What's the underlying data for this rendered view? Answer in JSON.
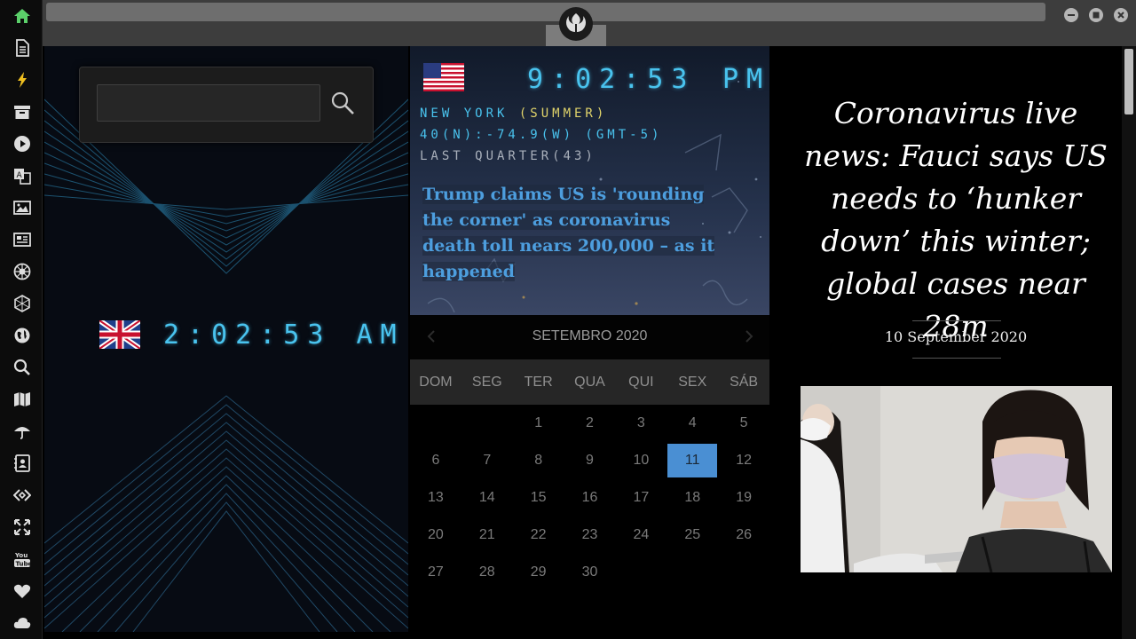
{
  "sidebar": {
    "icons": [
      "home-icon",
      "document-icon",
      "lightning-icon",
      "archive-icon",
      "play-icon",
      "translate-icon",
      "image-icon",
      "newspaper-icon",
      "rebel-alliance-icon",
      "hexagon-network-icon",
      "globe-icon",
      "search-icon",
      "map-icon",
      "umbrella-icon",
      "contacts-icon",
      "code-link-icon",
      "fullscreen-icon",
      "youtube-icon",
      "heart-icon",
      "cloud-icon"
    ],
    "active_color": "#5bd06a"
  },
  "window": {
    "controls": [
      "minimize-icon",
      "maximize-icon",
      "close-icon"
    ]
  },
  "search": {
    "value": ""
  },
  "uk_clock": {
    "flag": "uk-flag-icon",
    "time": "2:02:53",
    "ampm": "AM"
  },
  "us_clock": {
    "flag": "us-flag-icon",
    "time": "9:02:53",
    "ampm": "PM",
    "city": "NEW YORK ",
    "season": "(SUMMER)",
    "coords": "40(N):-74.9(W) (GMT-5)",
    "moon": "LAST QUARTER(43)"
  },
  "left_news": {
    "headline": "Trump claims US is 'rounding the corner' as coronavirus death toll nears 200,000 – as it happened"
  },
  "calendar": {
    "month": "SETEMBRO 2020",
    "weekdays": [
      "DOM",
      "SEG",
      "TER",
      "QUA",
      "QUI",
      "SEX",
      "SÁB"
    ],
    "leading_blanks": 2,
    "days": [
      "1",
      "2",
      "3",
      "4",
      "5",
      "6",
      "7",
      "8",
      "9",
      "10",
      "11",
      "12",
      "13",
      "14",
      "15",
      "16",
      "17",
      "18",
      "19",
      "20",
      "21",
      "22",
      "23",
      "24",
      "25",
      "26",
      "27",
      "28",
      "29",
      "30"
    ],
    "selected": "11",
    "accent": "#4a8fd3"
  },
  "article": {
    "title": "Coronavirus live news: Fauci says US needs to ‘hunker down’ this winter; global cases near 28m",
    "date": "10 September 2020"
  },
  "colors": {
    "clock": "#49c3ee",
    "headline": "#4d9ede"
  }
}
